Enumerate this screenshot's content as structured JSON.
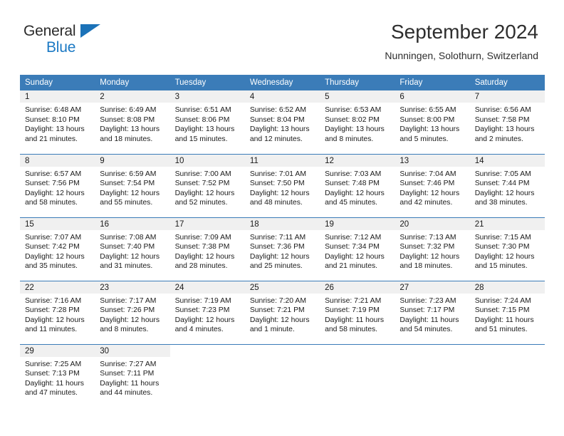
{
  "brand": {
    "name_line1": "General",
    "name_line2": "Blue",
    "logo_icon": "triangle-icon",
    "color_dark": "#2b2b2b",
    "color_blue": "#1b79c4"
  },
  "header": {
    "title": "September 2024",
    "subtitle": "Nunningen, Solothurn, Switzerland"
  },
  "theme": {
    "header_bg": "#3b7cb8",
    "daynum_bg": "#f0f0f0",
    "rule_color": "#3b7cb8",
    "text_color": "#1a1a1a"
  },
  "labels": {
    "sunrise": "Sunrise:",
    "sunset": "Sunset:",
    "daylight": "Daylight:"
  },
  "weekday_headers": [
    "Sunday",
    "Monday",
    "Tuesday",
    "Wednesday",
    "Thursday",
    "Friday",
    "Saturday"
  ],
  "weeks": [
    [
      {
        "day": "1",
        "sunrise": "Sunrise: 6:48 AM",
        "sunset": "Sunset: 8:10 PM",
        "daylight_l1": "Daylight: 13 hours",
        "daylight_l2": "and 21 minutes."
      },
      {
        "day": "2",
        "sunrise": "Sunrise: 6:49 AM",
        "sunset": "Sunset: 8:08 PM",
        "daylight_l1": "Daylight: 13 hours",
        "daylight_l2": "and 18 minutes."
      },
      {
        "day": "3",
        "sunrise": "Sunrise: 6:51 AM",
        "sunset": "Sunset: 8:06 PM",
        "daylight_l1": "Daylight: 13 hours",
        "daylight_l2": "and 15 minutes."
      },
      {
        "day": "4",
        "sunrise": "Sunrise: 6:52 AM",
        "sunset": "Sunset: 8:04 PM",
        "daylight_l1": "Daylight: 13 hours",
        "daylight_l2": "and 12 minutes."
      },
      {
        "day": "5",
        "sunrise": "Sunrise: 6:53 AM",
        "sunset": "Sunset: 8:02 PM",
        "daylight_l1": "Daylight: 13 hours",
        "daylight_l2": "and 8 minutes."
      },
      {
        "day": "6",
        "sunrise": "Sunrise: 6:55 AM",
        "sunset": "Sunset: 8:00 PM",
        "daylight_l1": "Daylight: 13 hours",
        "daylight_l2": "and 5 minutes."
      },
      {
        "day": "7",
        "sunrise": "Sunrise: 6:56 AM",
        "sunset": "Sunset: 7:58 PM",
        "daylight_l1": "Daylight: 13 hours",
        "daylight_l2": "and 2 minutes."
      }
    ],
    [
      {
        "day": "8",
        "sunrise": "Sunrise: 6:57 AM",
        "sunset": "Sunset: 7:56 PM",
        "daylight_l1": "Daylight: 12 hours",
        "daylight_l2": "and 58 minutes."
      },
      {
        "day": "9",
        "sunrise": "Sunrise: 6:59 AM",
        "sunset": "Sunset: 7:54 PM",
        "daylight_l1": "Daylight: 12 hours",
        "daylight_l2": "and 55 minutes."
      },
      {
        "day": "10",
        "sunrise": "Sunrise: 7:00 AM",
        "sunset": "Sunset: 7:52 PM",
        "daylight_l1": "Daylight: 12 hours",
        "daylight_l2": "and 52 minutes."
      },
      {
        "day": "11",
        "sunrise": "Sunrise: 7:01 AM",
        "sunset": "Sunset: 7:50 PM",
        "daylight_l1": "Daylight: 12 hours",
        "daylight_l2": "and 48 minutes."
      },
      {
        "day": "12",
        "sunrise": "Sunrise: 7:03 AM",
        "sunset": "Sunset: 7:48 PM",
        "daylight_l1": "Daylight: 12 hours",
        "daylight_l2": "and 45 minutes."
      },
      {
        "day": "13",
        "sunrise": "Sunrise: 7:04 AM",
        "sunset": "Sunset: 7:46 PM",
        "daylight_l1": "Daylight: 12 hours",
        "daylight_l2": "and 42 minutes."
      },
      {
        "day": "14",
        "sunrise": "Sunrise: 7:05 AM",
        "sunset": "Sunset: 7:44 PM",
        "daylight_l1": "Daylight: 12 hours",
        "daylight_l2": "and 38 minutes."
      }
    ],
    [
      {
        "day": "15",
        "sunrise": "Sunrise: 7:07 AM",
        "sunset": "Sunset: 7:42 PM",
        "daylight_l1": "Daylight: 12 hours",
        "daylight_l2": "and 35 minutes."
      },
      {
        "day": "16",
        "sunrise": "Sunrise: 7:08 AM",
        "sunset": "Sunset: 7:40 PM",
        "daylight_l1": "Daylight: 12 hours",
        "daylight_l2": "and 31 minutes."
      },
      {
        "day": "17",
        "sunrise": "Sunrise: 7:09 AM",
        "sunset": "Sunset: 7:38 PM",
        "daylight_l1": "Daylight: 12 hours",
        "daylight_l2": "and 28 minutes."
      },
      {
        "day": "18",
        "sunrise": "Sunrise: 7:11 AM",
        "sunset": "Sunset: 7:36 PM",
        "daylight_l1": "Daylight: 12 hours",
        "daylight_l2": "and 25 minutes."
      },
      {
        "day": "19",
        "sunrise": "Sunrise: 7:12 AM",
        "sunset": "Sunset: 7:34 PM",
        "daylight_l1": "Daylight: 12 hours",
        "daylight_l2": "and 21 minutes."
      },
      {
        "day": "20",
        "sunrise": "Sunrise: 7:13 AM",
        "sunset": "Sunset: 7:32 PM",
        "daylight_l1": "Daylight: 12 hours",
        "daylight_l2": "and 18 minutes."
      },
      {
        "day": "21",
        "sunrise": "Sunrise: 7:15 AM",
        "sunset": "Sunset: 7:30 PM",
        "daylight_l1": "Daylight: 12 hours",
        "daylight_l2": "and 15 minutes."
      }
    ],
    [
      {
        "day": "22",
        "sunrise": "Sunrise: 7:16 AM",
        "sunset": "Sunset: 7:28 PM",
        "daylight_l1": "Daylight: 12 hours",
        "daylight_l2": "and 11 minutes."
      },
      {
        "day": "23",
        "sunrise": "Sunrise: 7:17 AM",
        "sunset": "Sunset: 7:26 PM",
        "daylight_l1": "Daylight: 12 hours",
        "daylight_l2": "and 8 minutes."
      },
      {
        "day": "24",
        "sunrise": "Sunrise: 7:19 AM",
        "sunset": "Sunset: 7:23 PM",
        "daylight_l1": "Daylight: 12 hours",
        "daylight_l2": "and 4 minutes."
      },
      {
        "day": "25",
        "sunrise": "Sunrise: 7:20 AM",
        "sunset": "Sunset: 7:21 PM",
        "daylight_l1": "Daylight: 12 hours",
        "daylight_l2": "and 1 minute."
      },
      {
        "day": "26",
        "sunrise": "Sunrise: 7:21 AM",
        "sunset": "Sunset: 7:19 PM",
        "daylight_l1": "Daylight: 11 hours",
        "daylight_l2": "and 58 minutes."
      },
      {
        "day": "27",
        "sunrise": "Sunrise: 7:23 AM",
        "sunset": "Sunset: 7:17 PM",
        "daylight_l1": "Daylight: 11 hours",
        "daylight_l2": "and 54 minutes."
      },
      {
        "day": "28",
        "sunrise": "Sunrise: 7:24 AM",
        "sunset": "Sunset: 7:15 PM",
        "daylight_l1": "Daylight: 11 hours",
        "daylight_l2": "and 51 minutes."
      }
    ],
    [
      {
        "day": "29",
        "sunrise": "Sunrise: 7:25 AM",
        "sunset": "Sunset: 7:13 PM",
        "daylight_l1": "Daylight: 11 hours",
        "daylight_l2": "and 47 minutes."
      },
      {
        "day": "30",
        "sunrise": "Sunrise: 7:27 AM",
        "sunset": "Sunset: 7:11 PM",
        "daylight_l1": "Daylight: 11 hours",
        "daylight_l2": "and 44 minutes."
      },
      {
        "day": "",
        "sunrise": "",
        "sunset": "",
        "daylight_l1": "",
        "daylight_l2": ""
      },
      {
        "day": "",
        "sunrise": "",
        "sunset": "",
        "daylight_l1": "",
        "daylight_l2": ""
      },
      {
        "day": "",
        "sunrise": "",
        "sunset": "",
        "daylight_l1": "",
        "daylight_l2": ""
      },
      {
        "day": "",
        "sunrise": "",
        "sunset": "",
        "daylight_l1": "",
        "daylight_l2": ""
      },
      {
        "day": "",
        "sunrise": "",
        "sunset": "",
        "daylight_l1": "",
        "daylight_l2": ""
      }
    ]
  ]
}
